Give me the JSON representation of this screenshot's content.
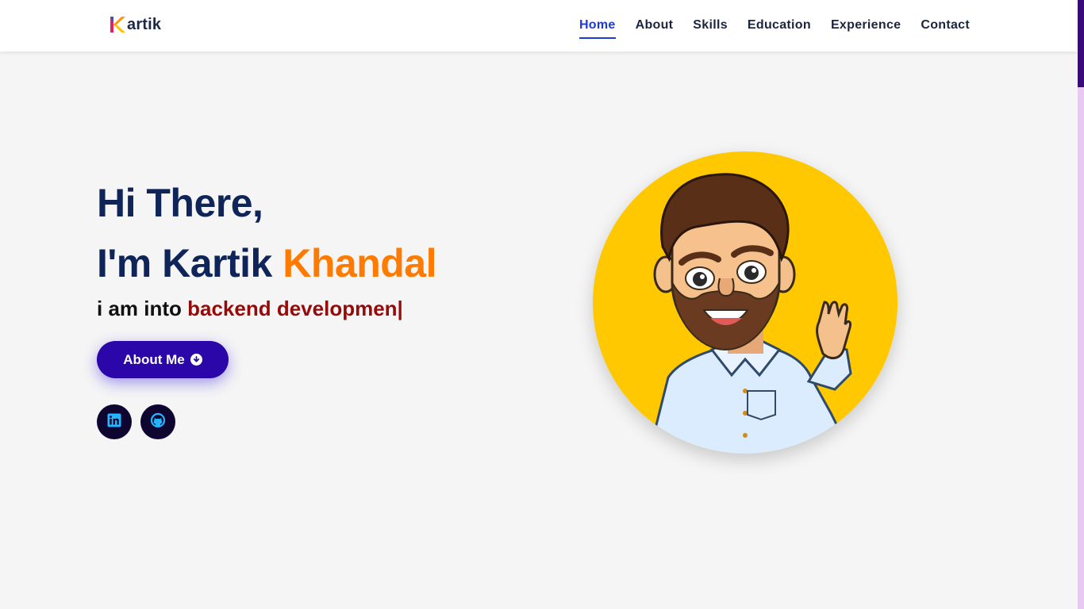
{
  "header": {
    "logo_text": "artik",
    "nav": [
      {
        "label": "Home",
        "active": true
      },
      {
        "label": "About",
        "active": false
      },
      {
        "label": "Skills",
        "active": false
      },
      {
        "label": "Education",
        "active": false
      },
      {
        "label": "Experience",
        "active": false
      },
      {
        "label": "Contact",
        "active": false
      }
    ]
  },
  "hero": {
    "greeting": "Hi There,",
    "intro_prefix": "I'm Kartik ",
    "intro_accent": "Khandal",
    "subtitle_prefix": "i am into ",
    "subtitle_typed": "backend developmen|",
    "about_button": "About Me",
    "socials": [
      {
        "icon": "linkedin-icon"
      },
      {
        "icon": "github-icon"
      }
    ],
    "avatar_icon": "cartoon-avatar-icon"
  },
  "colors": {
    "accent_blue": "#1f3bd6",
    "navy": "#0f2459",
    "orange": "#ff7a00",
    "typed_red": "#960a0a",
    "button_purple": "#2b06a8",
    "avatar_yellow": "#ffc800"
  }
}
